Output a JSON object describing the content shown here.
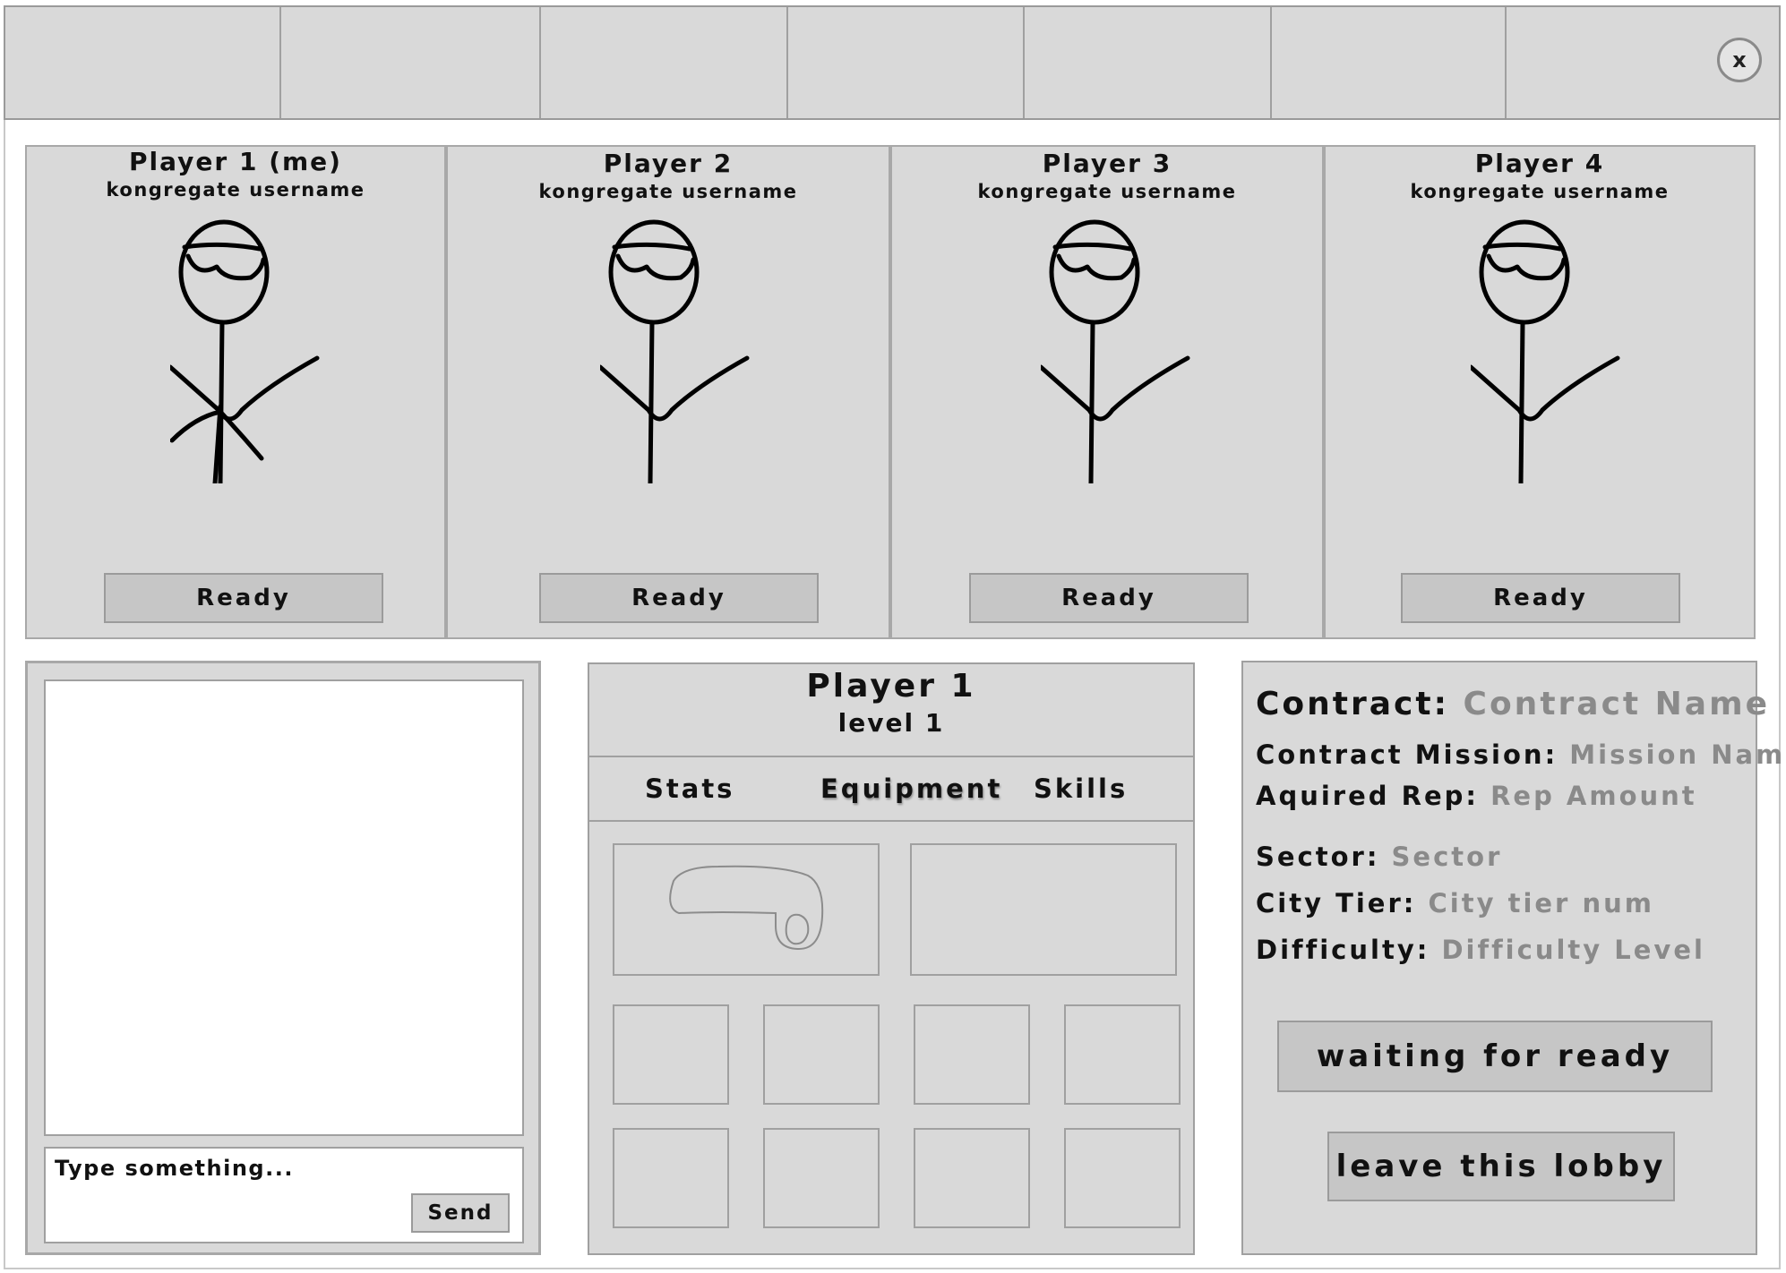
{
  "close_button": {
    "label": "x"
  },
  "players": [
    {
      "name": "Player 1 (me)",
      "username": "kongregate username",
      "ready_label": "Ready"
    },
    {
      "name": "Player 2",
      "username": "kongregate username",
      "ready_label": "Ready"
    },
    {
      "name": "Player 3",
      "username": "kongregate username",
      "ready_label": "Ready"
    },
    {
      "name": "Player 4",
      "username": "kongregate username",
      "ready_label": "Ready"
    }
  ],
  "chat": {
    "placeholder": "Type something...",
    "send_label": "Send"
  },
  "character": {
    "name": "Player 1",
    "level": "level 1",
    "tabs": [
      "Stats",
      "Equipment",
      "Skills"
    ],
    "active_tab": "Equipment"
  },
  "contract": {
    "contract_label": "Contract:",
    "contract_value": "Contract Name",
    "mission_label": "Contract Mission:",
    "mission_value": "Mission Name",
    "rep_label": "Aquired Rep:",
    "rep_value": "Rep Amount",
    "sector_label": "Sector:",
    "sector_value": "Sector",
    "tier_label": "City Tier:",
    "tier_value": "City tier num",
    "difficulty_label": "Difficulty:",
    "difficulty_value": "Difficulty Level"
  },
  "actions": {
    "waiting_label": "waiting for ready",
    "leave_label": "leave this lobby"
  }
}
